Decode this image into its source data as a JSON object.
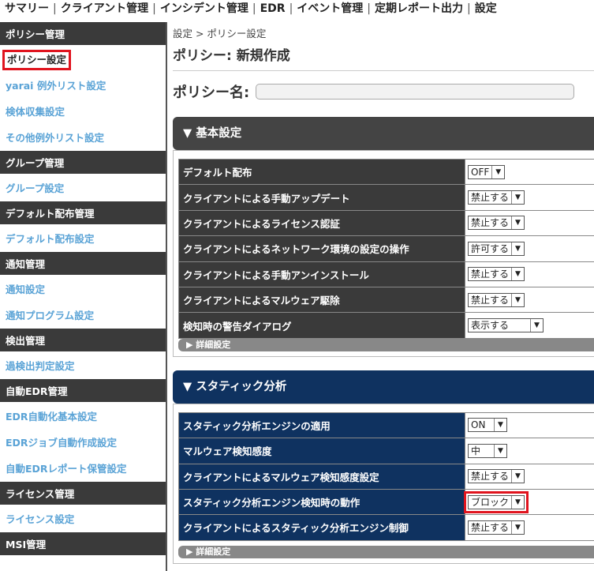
{
  "topnav": {
    "items": [
      "サマリー",
      "クライアント管理",
      "インシデント管理",
      "EDR",
      "イベント管理",
      "定期レポート出力",
      "設定"
    ],
    "separator": "|"
  },
  "sidebar": {
    "groups": [
      {
        "header": "ポリシー管理",
        "items": [
          "ポリシー設定",
          "yarai 例外リスト設定",
          "検体収集設定",
          "その他例外リスト設定"
        ]
      },
      {
        "header": "グループ管理",
        "items": [
          "グループ設定"
        ]
      },
      {
        "header": "デフォルト配布管理",
        "items": [
          "デフォルト配布設定"
        ]
      },
      {
        "header": "通知管理",
        "items": [
          "通知設定",
          "通知プログラム設定"
        ]
      },
      {
        "header": "検出管理",
        "items": [
          "過検出判定設定"
        ]
      },
      {
        "header": "自動EDR管理",
        "items": [
          "EDR自動化基本設定",
          "EDRジョブ自動作成設定",
          "自動EDRレポート保管設定"
        ]
      },
      {
        "header": "ライセンス管理",
        "items": [
          "ライセンス設定"
        ]
      },
      {
        "header": "MSI管理",
        "items": []
      }
    ],
    "active_item": "ポリシー設定"
  },
  "main": {
    "breadcrumb": "設定 > ポリシー設定",
    "page_title": "ポリシー: 新規作成",
    "policy_name_label": "ポリシー名:",
    "policy_name_value": "",
    "sections": [
      {
        "title": "▼ 基本設定",
        "rows": [
          {
            "label": "デフォルト配布",
            "value": "OFF"
          },
          {
            "label": "クライアントによる手動アップデート",
            "value": "禁止する"
          },
          {
            "label": "クライアントによるライセンス認証",
            "value": "禁止する"
          },
          {
            "label": "クライアントによるネットワーク環境の設定の操作",
            "value": "許可する"
          },
          {
            "label": "クライアントによる手動アンインストール",
            "value": "禁止する"
          },
          {
            "label": "クライアントによるマルウェア駆除",
            "value": "禁止する"
          },
          {
            "label": "検知時の警告ダイアログ",
            "value": "表示する"
          }
        ],
        "detail": "▶ 詳細設定"
      },
      {
        "title": "▼ スタティック分析",
        "rows": [
          {
            "label": "スタティック分析エンジンの適用",
            "value": "ON"
          },
          {
            "label": "マルウェア検知感度",
            "value": "中"
          },
          {
            "label": "クライアントによるマルウェア検知感度設定",
            "value": "禁止する"
          },
          {
            "label": "スタティック分析エンジン検知時の動作",
            "value": "ブロック"
          },
          {
            "label": "クライアントによるスタティック分析エンジン制御",
            "value": "禁止する"
          }
        ],
        "detail": "▶ 詳細設定"
      }
    ]
  },
  "icons": {
    "dropdown": "chevron-down-icon"
  },
  "colors": {
    "highlight": "#e0141e",
    "navy": "#0f3260",
    "dark": "#3a3a3a",
    "link": "#5aa3d6"
  }
}
